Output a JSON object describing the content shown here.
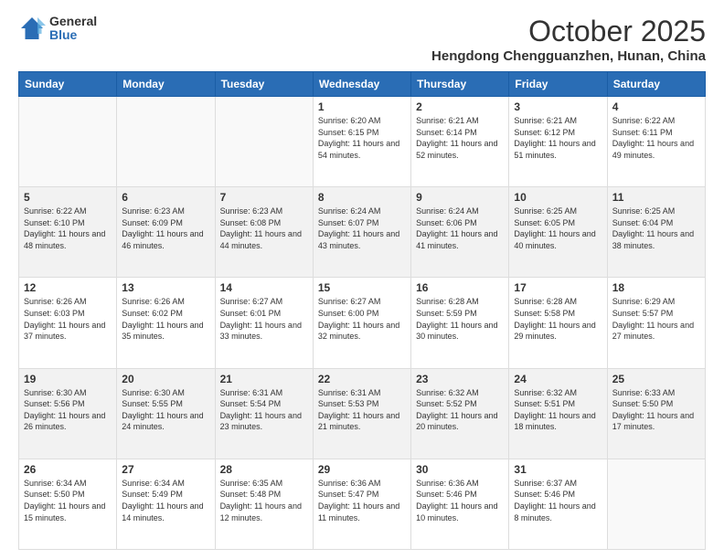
{
  "logo": {
    "general": "General",
    "blue": "Blue"
  },
  "title": "October 2025",
  "location": "Hengdong Chengguanzhen, Hunan, China",
  "days_of_week": [
    "Sunday",
    "Monday",
    "Tuesday",
    "Wednesday",
    "Thursday",
    "Friday",
    "Saturday"
  ],
  "weeks": [
    [
      {
        "day": "",
        "sunrise": "",
        "sunset": "",
        "daylight": ""
      },
      {
        "day": "",
        "sunrise": "",
        "sunset": "",
        "daylight": ""
      },
      {
        "day": "",
        "sunrise": "",
        "sunset": "",
        "daylight": ""
      },
      {
        "day": "1",
        "sunrise": "Sunrise: 6:20 AM",
        "sunset": "Sunset: 6:15 PM",
        "daylight": "Daylight: 11 hours and 54 minutes."
      },
      {
        "day": "2",
        "sunrise": "Sunrise: 6:21 AM",
        "sunset": "Sunset: 6:14 PM",
        "daylight": "Daylight: 11 hours and 52 minutes."
      },
      {
        "day": "3",
        "sunrise": "Sunrise: 6:21 AM",
        "sunset": "Sunset: 6:12 PM",
        "daylight": "Daylight: 11 hours and 51 minutes."
      },
      {
        "day": "4",
        "sunrise": "Sunrise: 6:22 AM",
        "sunset": "Sunset: 6:11 PM",
        "daylight": "Daylight: 11 hours and 49 minutes."
      }
    ],
    [
      {
        "day": "5",
        "sunrise": "Sunrise: 6:22 AM",
        "sunset": "Sunset: 6:10 PM",
        "daylight": "Daylight: 11 hours and 48 minutes."
      },
      {
        "day": "6",
        "sunrise": "Sunrise: 6:23 AM",
        "sunset": "Sunset: 6:09 PM",
        "daylight": "Daylight: 11 hours and 46 minutes."
      },
      {
        "day": "7",
        "sunrise": "Sunrise: 6:23 AM",
        "sunset": "Sunset: 6:08 PM",
        "daylight": "Daylight: 11 hours and 44 minutes."
      },
      {
        "day": "8",
        "sunrise": "Sunrise: 6:24 AM",
        "sunset": "Sunset: 6:07 PM",
        "daylight": "Daylight: 11 hours and 43 minutes."
      },
      {
        "day": "9",
        "sunrise": "Sunrise: 6:24 AM",
        "sunset": "Sunset: 6:06 PM",
        "daylight": "Daylight: 11 hours and 41 minutes."
      },
      {
        "day": "10",
        "sunrise": "Sunrise: 6:25 AM",
        "sunset": "Sunset: 6:05 PM",
        "daylight": "Daylight: 11 hours and 40 minutes."
      },
      {
        "day": "11",
        "sunrise": "Sunrise: 6:25 AM",
        "sunset": "Sunset: 6:04 PM",
        "daylight": "Daylight: 11 hours and 38 minutes."
      }
    ],
    [
      {
        "day": "12",
        "sunrise": "Sunrise: 6:26 AM",
        "sunset": "Sunset: 6:03 PM",
        "daylight": "Daylight: 11 hours and 37 minutes."
      },
      {
        "day": "13",
        "sunrise": "Sunrise: 6:26 AM",
        "sunset": "Sunset: 6:02 PM",
        "daylight": "Daylight: 11 hours and 35 minutes."
      },
      {
        "day": "14",
        "sunrise": "Sunrise: 6:27 AM",
        "sunset": "Sunset: 6:01 PM",
        "daylight": "Daylight: 11 hours and 33 minutes."
      },
      {
        "day": "15",
        "sunrise": "Sunrise: 6:27 AM",
        "sunset": "Sunset: 6:00 PM",
        "daylight": "Daylight: 11 hours and 32 minutes."
      },
      {
        "day": "16",
        "sunrise": "Sunrise: 6:28 AM",
        "sunset": "Sunset: 5:59 PM",
        "daylight": "Daylight: 11 hours and 30 minutes."
      },
      {
        "day": "17",
        "sunrise": "Sunrise: 6:28 AM",
        "sunset": "Sunset: 5:58 PM",
        "daylight": "Daylight: 11 hours and 29 minutes."
      },
      {
        "day": "18",
        "sunrise": "Sunrise: 6:29 AM",
        "sunset": "Sunset: 5:57 PM",
        "daylight": "Daylight: 11 hours and 27 minutes."
      }
    ],
    [
      {
        "day": "19",
        "sunrise": "Sunrise: 6:30 AM",
        "sunset": "Sunset: 5:56 PM",
        "daylight": "Daylight: 11 hours and 26 minutes."
      },
      {
        "day": "20",
        "sunrise": "Sunrise: 6:30 AM",
        "sunset": "Sunset: 5:55 PM",
        "daylight": "Daylight: 11 hours and 24 minutes."
      },
      {
        "day": "21",
        "sunrise": "Sunrise: 6:31 AM",
        "sunset": "Sunset: 5:54 PM",
        "daylight": "Daylight: 11 hours and 23 minutes."
      },
      {
        "day": "22",
        "sunrise": "Sunrise: 6:31 AM",
        "sunset": "Sunset: 5:53 PM",
        "daylight": "Daylight: 11 hours and 21 minutes."
      },
      {
        "day": "23",
        "sunrise": "Sunrise: 6:32 AM",
        "sunset": "Sunset: 5:52 PM",
        "daylight": "Daylight: 11 hours and 20 minutes."
      },
      {
        "day": "24",
        "sunrise": "Sunrise: 6:32 AM",
        "sunset": "Sunset: 5:51 PM",
        "daylight": "Daylight: 11 hours and 18 minutes."
      },
      {
        "day": "25",
        "sunrise": "Sunrise: 6:33 AM",
        "sunset": "Sunset: 5:50 PM",
        "daylight": "Daylight: 11 hours and 17 minutes."
      }
    ],
    [
      {
        "day": "26",
        "sunrise": "Sunrise: 6:34 AM",
        "sunset": "Sunset: 5:50 PM",
        "daylight": "Daylight: 11 hours and 15 minutes."
      },
      {
        "day": "27",
        "sunrise": "Sunrise: 6:34 AM",
        "sunset": "Sunset: 5:49 PM",
        "daylight": "Daylight: 11 hours and 14 minutes."
      },
      {
        "day": "28",
        "sunrise": "Sunrise: 6:35 AM",
        "sunset": "Sunset: 5:48 PM",
        "daylight": "Daylight: 11 hours and 12 minutes."
      },
      {
        "day": "29",
        "sunrise": "Sunrise: 6:36 AM",
        "sunset": "Sunset: 5:47 PM",
        "daylight": "Daylight: 11 hours and 11 minutes."
      },
      {
        "day": "30",
        "sunrise": "Sunrise: 6:36 AM",
        "sunset": "Sunset: 5:46 PM",
        "daylight": "Daylight: 11 hours and 10 minutes."
      },
      {
        "day": "31",
        "sunrise": "Sunrise: 6:37 AM",
        "sunset": "Sunset: 5:46 PM",
        "daylight": "Daylight: 11 hours and 8 minutes."
      },
      {
        "day": "",
        "sunrise": "",
        "sunset": "",
        "daylight": ""
      }
    ]
  ]
}
